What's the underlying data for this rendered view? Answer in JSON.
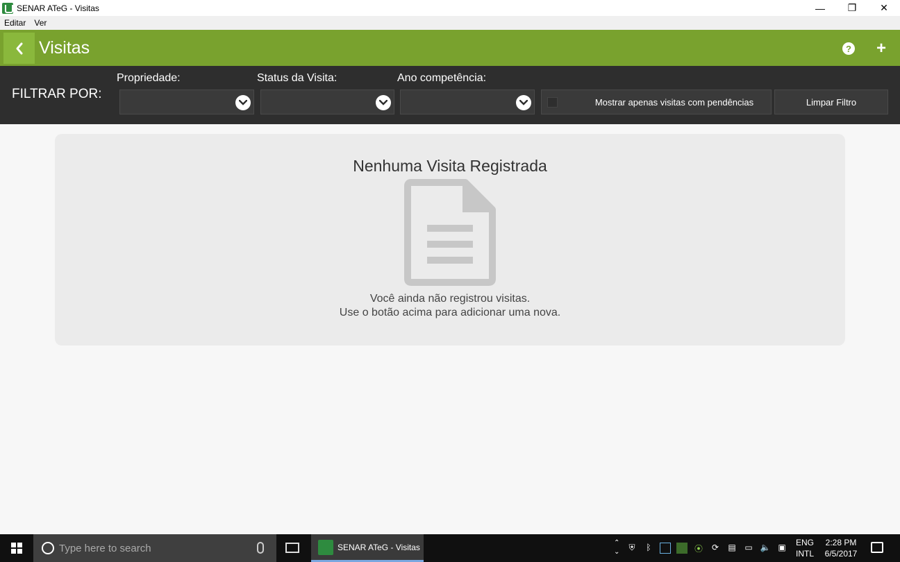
{
  "window": {
    "title": "SENAR ATeG - Visitas",
    "controls": {
      "minimize": "—",
      "restore": "❐",
      "close": "✕"
    }
  },
  "menu": {
    "items": [
      "Editar",
      "Ver"
    ]
  },
  "header": {
    "title": "Visitas",
    "back_icon": "chevron-left-icon",
    "help_label": "?",
    "add_label": "+",
    "color": "#79a22e"
  },
  "filters": {
    "heading": "FILTRAR POR:",
    "propriedade_label": "Propriedade:",
    "status_label": "Status da Visita:",
    "ano_label": "Ano competência:",
    "pendencias_label": "Mostrar apenas visitas com pendências",
    "clear_label": "Limpar Filtro"
  },
  "empty_state": {
    "title": "Nenhuma Visita Registrada",
    "line1": "Você ainda não registrou visitas.",
    "line2": "Use o botão acima para adicionar uma nova.",
    "icon": "document-icon"
  },
  "taskbar": {
    "search_placeholder": "Type here to search",
    "app_label": "SENAR ATeG - Visitas",
    "lang_line1": "ENG",
    "lang_line2": "INTL",
    "time": "2:28 PM",
    "date": "6/5/2017"
  }
}
